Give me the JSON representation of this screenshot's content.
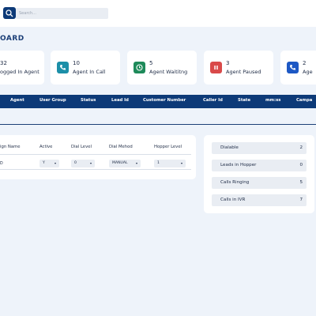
{
  "search": {
    "placeholder": "Search..."
  },
  "page": {
    "title": "OARD"
  },
  "stats": [
    {
      "value": "32",
      "label": "ogged In Agent",
      "icon": "users-icon",
      "color": "#1f3f8a"
    },
    {
      "value": "10",
      "label": "Agent In Call",
      "icon": "phone-in-call-icon",
      "color": "#1c8fa8"
    },
    {
      "value": "5",
      "label": "Agent Waititng",
      "icon": "clock-icon",
      "color": "#1e8a5a"
    },
    {
      "value": "3",
      "label": "Agent Paused",
      "icon": "pause-icon",
      "color": "#d94a4a"
    },
    {
      "value": "2",
      "label": "Age",
      "icon": "phone-icon",
      "color": "#1d58c4"
    }
  ],
  "agents_table": {
    "columns": [
      "Agent",
      "User Group",
      "Status",
      "Lead Id",
      "Customer Number",
      "Caller Id",
      "State",
      "mm:ss",
      "Campa"
    ]
  },
  "campaign_table": {
    "columns": [
      "ign Name",
      "Active",
      "Dial Level",
      "Dial Mehod",
      "Hopper Level"
    ],
    "row": {
      "name": "D",
      "active": "Y",
      "dial_level": "0",
      "dial_method": "MANUAL",
      "hopper_level": "1"
    }
  },
  "counts": [
    {
      "label": "Dialable",
      "value": "2"
    },
    {
      "label": "Leads in Hopper",
      "value": "0"
    },
    {
      "label": "Calls Ringing",
      "value": "5"
    },
    {
      "label": "Calls in IVR",
      "value": "7"
    }
  ],
  "colors": {
    "primary": "#0d3a78",
    "background": "#eef3fa",
    "card": "#ffffff",
    "field": "#e9edf3"
  }
}
